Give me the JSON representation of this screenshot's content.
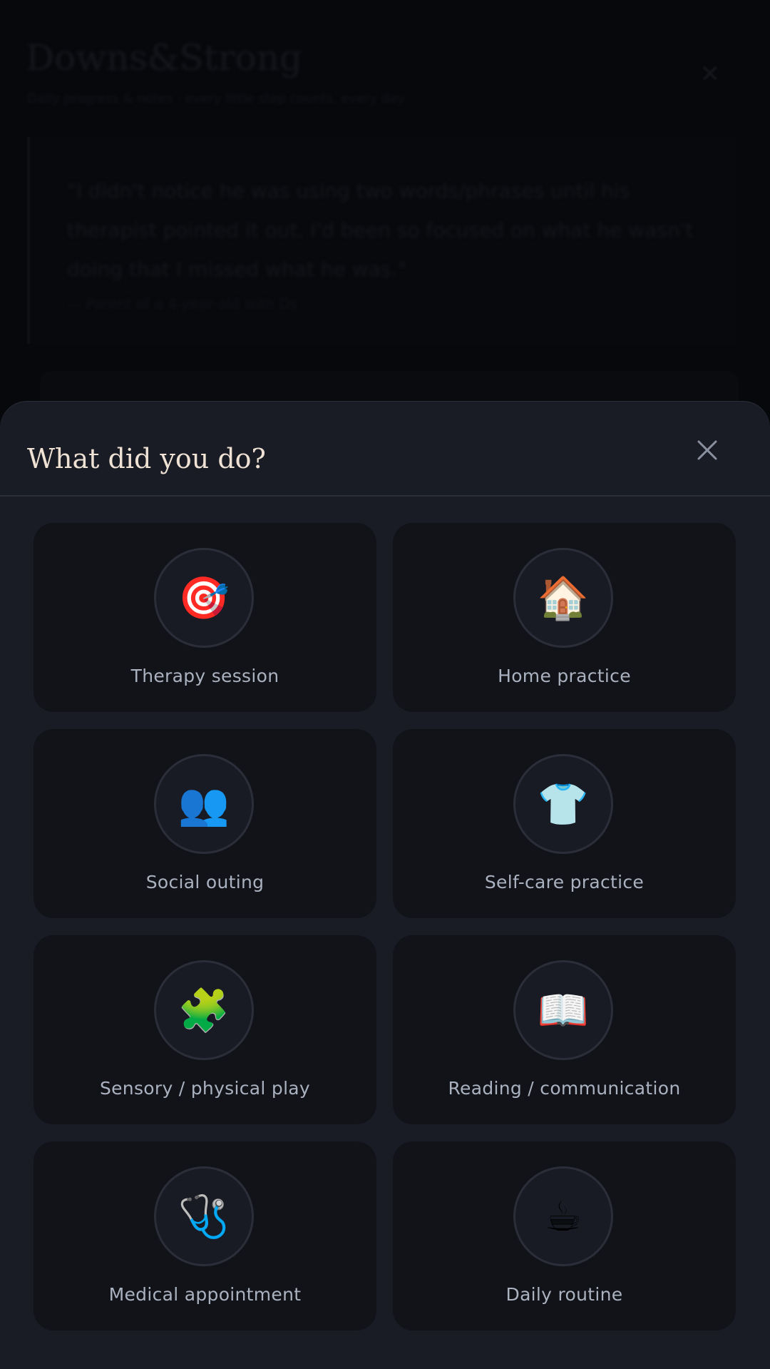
{
  "background": {
    "title": "Downs&Strong",
    "subtitle": "Daily progress & notes · every little step counts, every day",
    "quote": "\"I didn't notice he was using two words/phrases until his therapist pointed it out. I'd been so focused on what he wasn't doing that I missed what he was.\"",
    "quote_cite": "— Parent of a 4-year-old with Ds"
  },
  "sheet": {
    "title": "What did you do?",
    "close_icon": "close-icon"
  },
  "activities": [
    {
      "label": "Therapy session",
      "emoji": "🎯",
      "icon": "target-icon"
    },
    {
      "label": "Home practice",
      "emoji": "🏠",
      "icon": "house-icon"
    },
    {
      "label": "Social outing",
      "emoji": "👥",
      "icon": "people-icon"
    },
    {
      "label": "Self-care practice",
      "emoji": "👕",
      "icon": "shirt-icon"
    },
    {
      "label": "Sensory / physical play",
      "emoji": "🧩",
      "icon": "puzzle-icon"
    },
    {
      "label": "Reading / communication",
      "emoji": "📖",
      "icon": "book-icon"
    },
    {
      "label": "Medical appointment",
      "emoji": "🩺",
      "icon": "stethoscope-icon"
    },
    {
      "label": "Daily routine",
      "emoji": "☕",
      "icon": "coffee-icon"
    }
  ],
  "colors": {
    "sheet_bg": "#191c25",
    "tile_bg": "#111319",
    "title": "#efe2d4",
    "label": "#aab1bf"
  }
}
